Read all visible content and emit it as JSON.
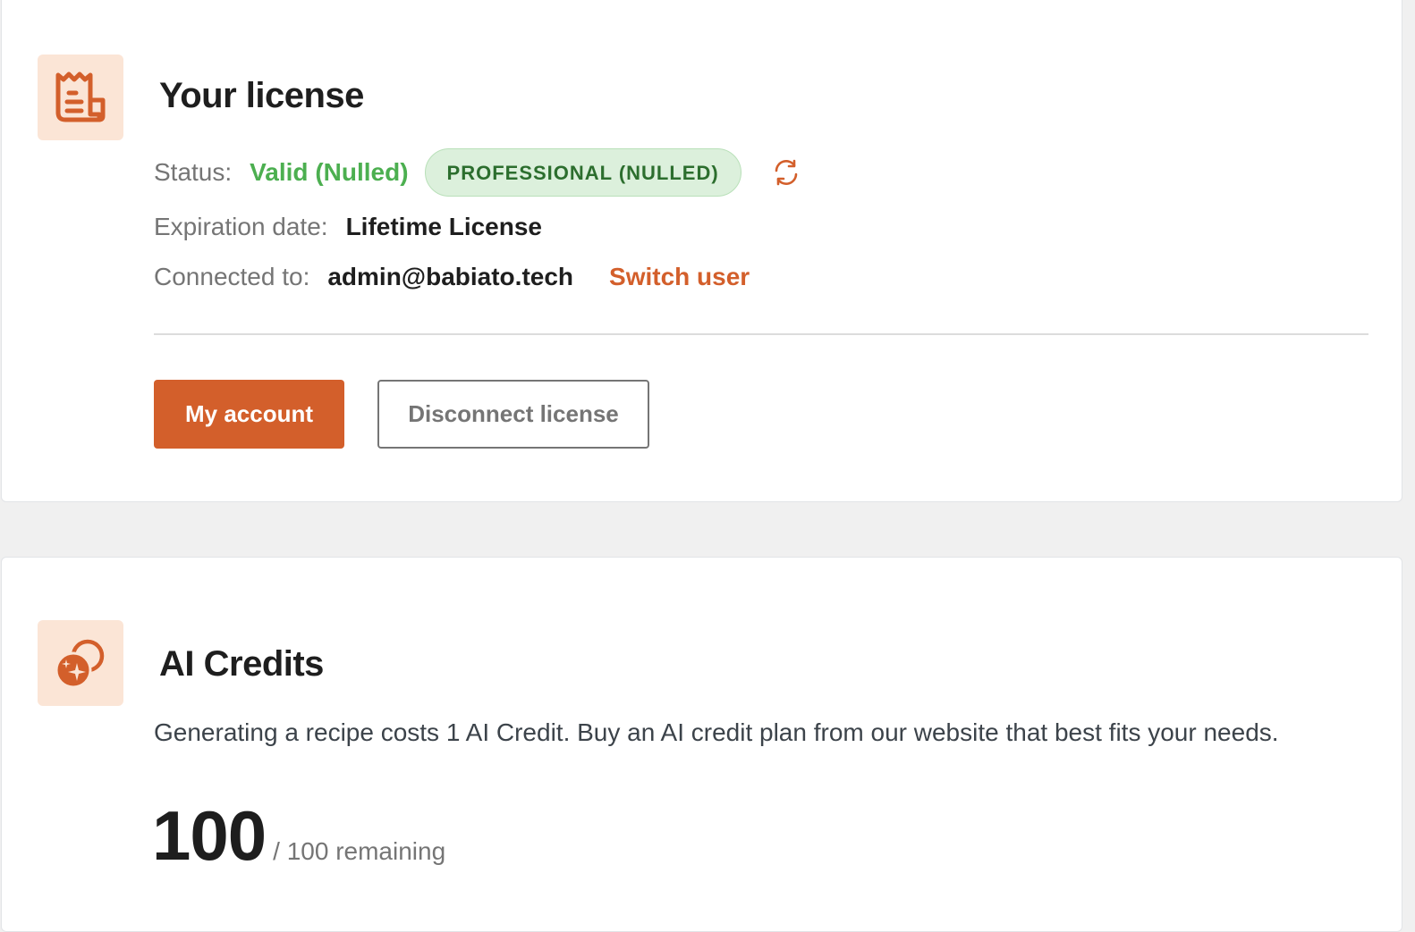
{
  "license": {
    "title": "Your license",
    "icon": "receipt-icon",
    "status_label": "Status:",
    "status_value": "Valid (Nulled)",
    "plan_badge": "PROFESSIONAL (NULLED)",
    "refresh_icon": "refresh-icon",
    "expiration_label": "Expiration date:",
    "expiration_value": "Lifetime License",
    "connected_label": "Connected to:",
    "connected_value": "admin@babiato.tech",
    "switch_user": "Switch user",
    "my_account_button": "My account",
    "disconnect_button": "Disconnect license"
  },
  "credits": {
    "title": "AI Credits",
    "icon": "coins-sparkle-icon",
    "description": "Generating a recipe costs 1 AI Credit. Buy an AI credit plan from our website that best fits your needs.",
    "remaining_count": "100",
    "remaining_suffix": "/ 100 remaining"
  },
  "colors": {
    "accent": "#d35f2b",
    "icon_tile_bg": "#fbe5d6",
    "status_valid": "#4caf50",
    "badge_bg": "#dcf0dc",
    "badge_text": "#2c6e2e",
    "page_bg": "#f0f0f0"
  }
}
